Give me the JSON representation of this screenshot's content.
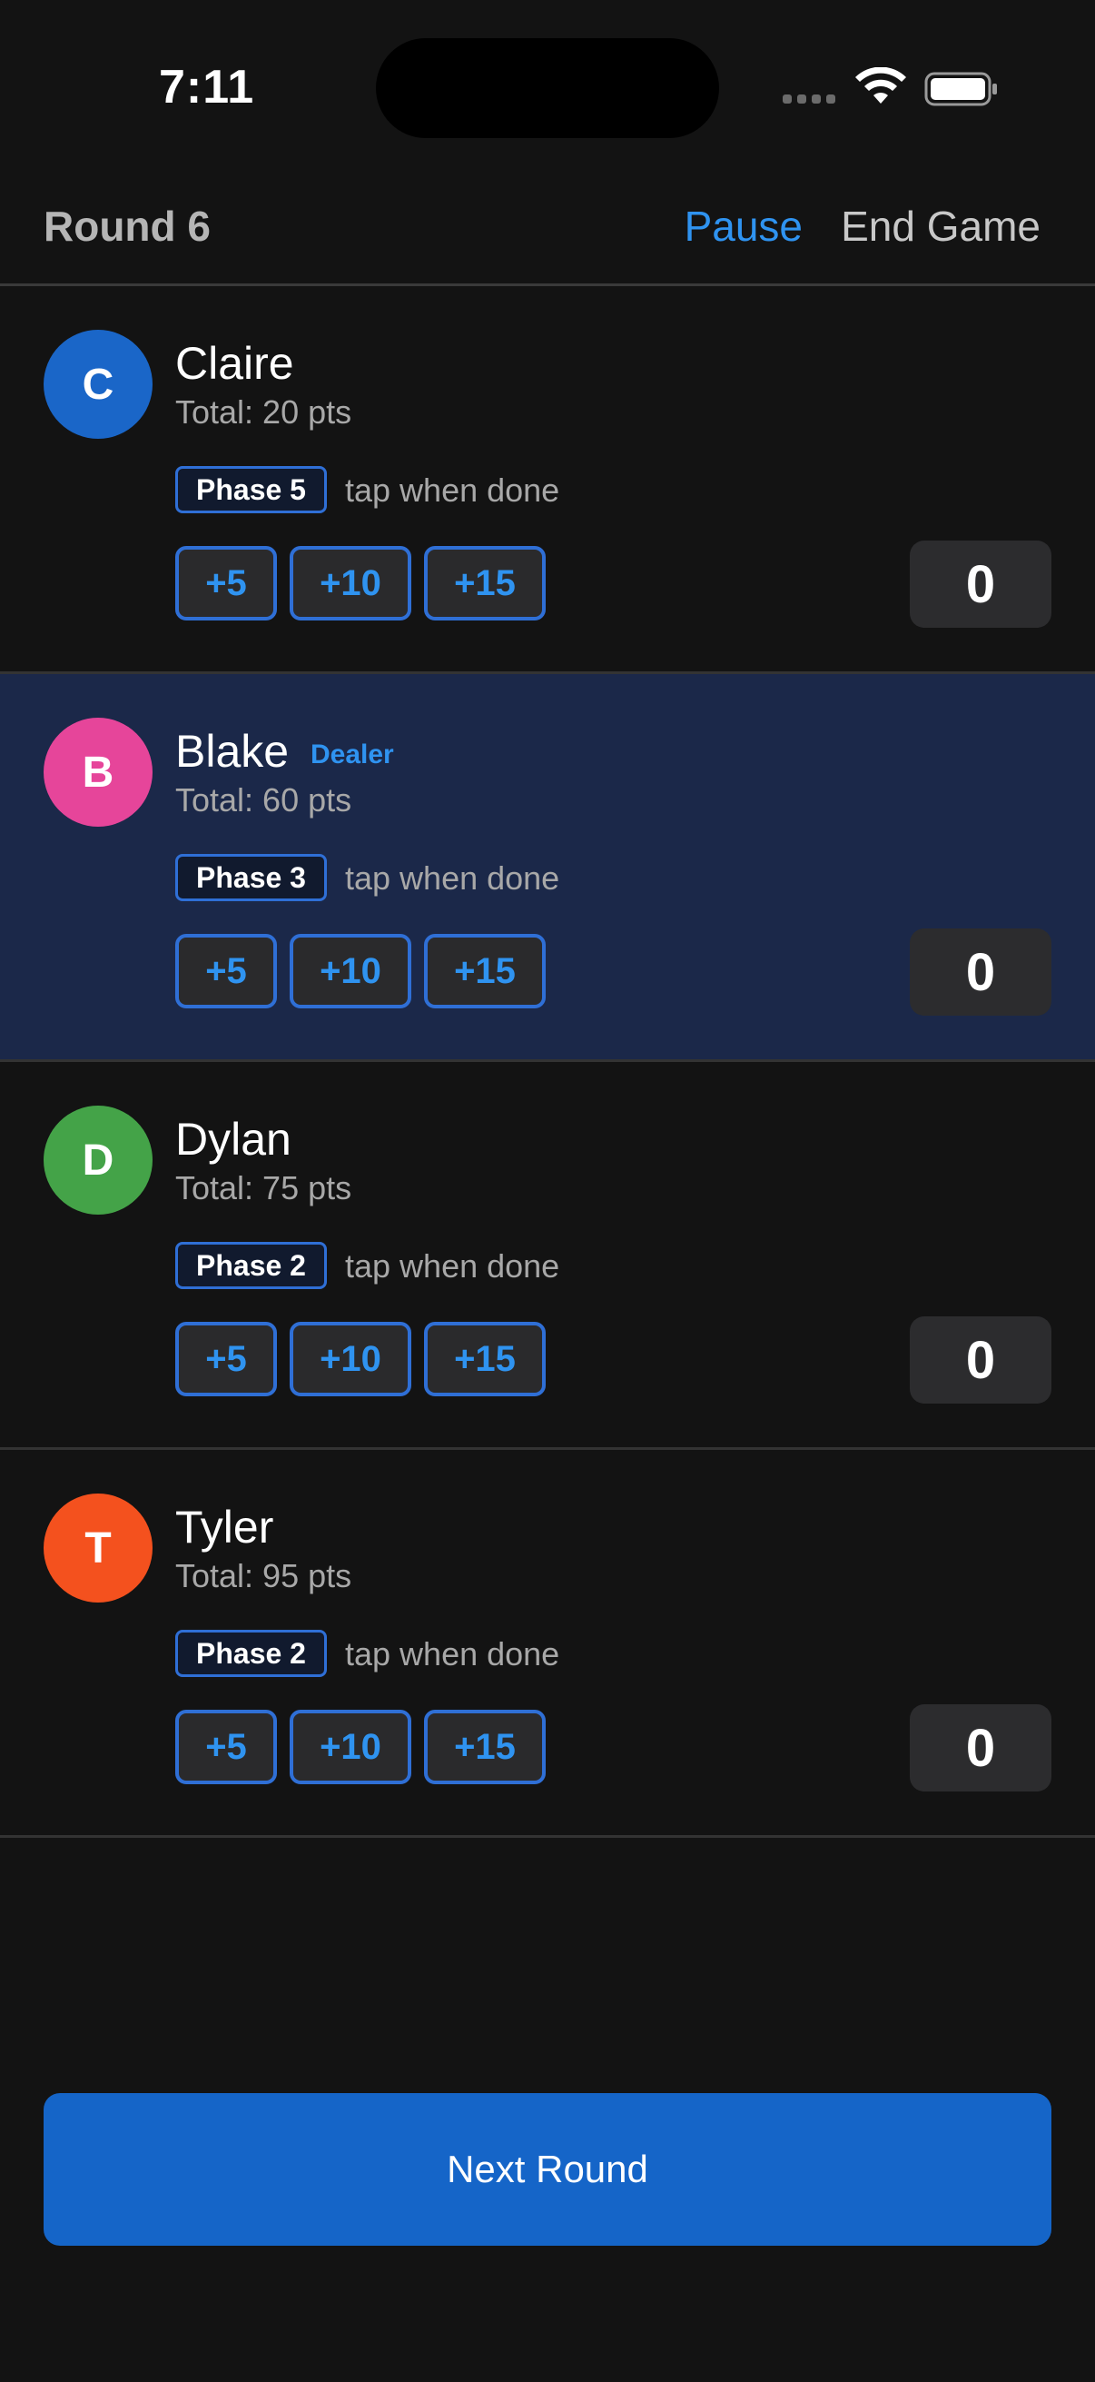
{
  "status_bar": {
    "time": "7:11"
  },
  "header": {
    "title": "Round 6",
    "pause_label": "Pause",
    "end_label": "End Game"
  },
  "colors": {
    "accent": "#2f93f0",
    "dealer_row_bg": "#1b2849",
    "primary_button": "#1565c8"
  },
  "players": [
    {
      "initial": "C",
      "name": "Claire",
      "avatar_color": "#1a66c8",
      "dealer": false,
      "dealer_label": "",
      "total": "Total: 20 pts",
      "phase": "Phase 5",
      "phase_hint": "tap when done",
      "bonus_buttons": [
        "+5",
        "+10",
        "+15"
      ],
      "score": "0"
    },
    {
      "initial": "B",
      "name": "Blake",
      "avatar_color": "#e6459a",
      "dealer": true,
      "dealer_label": "Dealer",
      "total": "Total: 60 pts",
      "phase": "Phase 3",
      "phase_hint": "tap when done",
      "bonus_buttons": [
        "+5",
        "+10",
        "+15"
      ],
      "score": "0"
    },
    {
      "initial": "D",
      "name": "Dylan",
      "avatar_color": "#44a348",
      "dealer": false,
      "dealer_label": "",
      "total": "Total: 75 pts",
      "phase": "Phase 2",
      "phase_hint": "tap when done",
      "bonus_buttons": [
        "+5",
        "+10",
        "+15"
      ],
      "score": "0"
    },
    {
      "initial": "T",
      "name": "Tyler",
      "avatar_color": "#f4511e",
      "dealer": false,
      "dealer_label": "",
      "total": "Total: 95 pts",
      "phase": "Phase 2",
      "phase_hint": "tap when done",
      "bonus_buttons": [
        "+5",
        "+10",
        "+15"
      ],
      "score": "0"
    }
  ],
  "footer": {
    "next_round_label": "Next Round"
  }
}
